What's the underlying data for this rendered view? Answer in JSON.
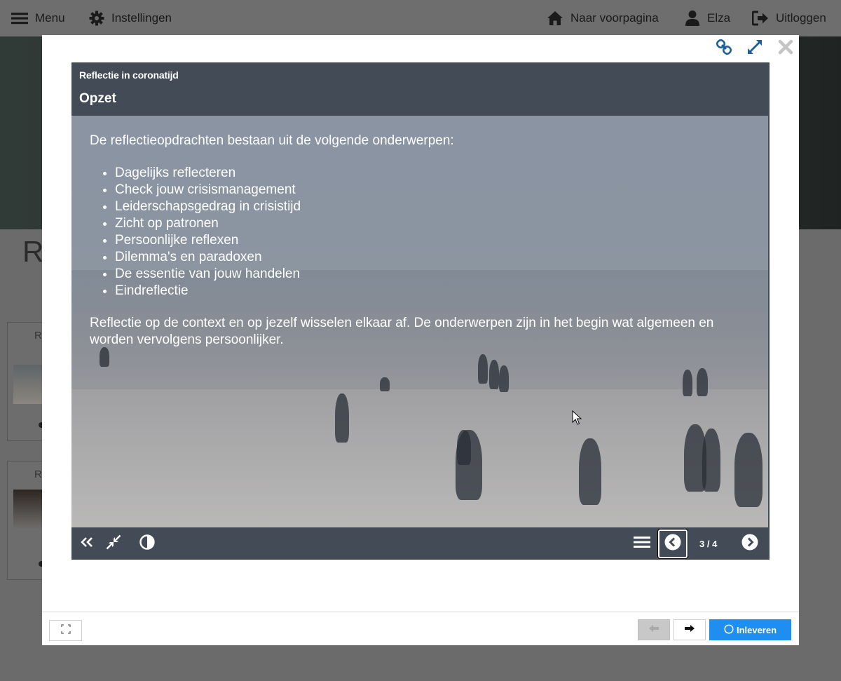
{
  "topbar": {
    "menu_label": "Menu",
    "settings_label": "Instellingen",
    "home_label": "Naar voorpagina",
    "user_label": "Elza",
    "logout_label": "Uitloggen"
  },
  "background": {
    "heading_initial": "R",
    "card_initials": [
      "R",
      "R"
    ]
  },
  "modal": {
    "icons": [
      "link-icon",
      "expand-icon",
      "close-icon"
    ]
  },
  "presentation": {
    "course_title": "Reflectie in coronatijd",
    "slide_title": "Opzet",
    "intro": "De reflectieopdrachten bestaan uit de volgende onderwerpen:",
    "topics": [
      "Dagelijks reflecteren",
      "Check jouw crisismanagement",
      "Leiderschapsgedrag in crisistijd",
      "Zicht op patronen",
      "Persoonlijke reflexen",
      "Dilemma's en paradoxen",
      "De essentie van jouw handelen",
      "Eindreflectie"
    ],
    "outro": "Reflectie op de context en op jezelf wisselen elkaar af. De onderwerpen zijn in het begin wat algemeen en worden vervolgens persoonlijker.",
    "page_indicator": "3 / 4",
    "current_page": 3,
    "total_pages": 4
  },
  "footer": {
    "submit_label": "Inleveren"
  },
  "colors": {
    "accent": "#1e8ff0",
    "header_bg": "#434b57",
    "icon_blue": "#1d5f9a"
  }
}
